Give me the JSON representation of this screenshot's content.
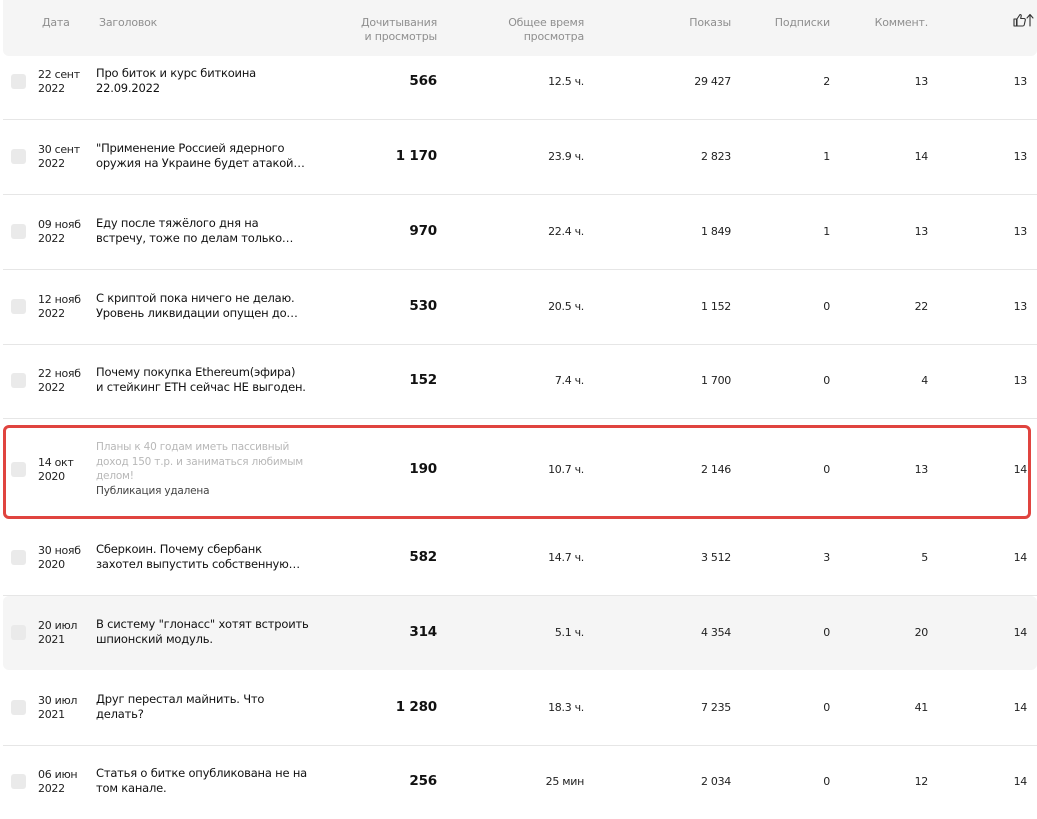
{
  "header": {
    "date": "Дата",
    "title": "Заголовок",
    "reads": [
      "Дочитывания",
      "и просмотры"
    ],
    "time": [
      "Общее время",
      "просмотра"
    ],
    "shows": "Показы",
    "subs": "Подписки",
    "comments": "Коммент."
  },
  "rows": [
    {
      "date": [
        "22 сент",
        "2022"
      ],
      "title": [
        "Про биток и курс биткоина",
        "22.09.2022"
      ],
      "reads": "566",
      "time": "12.5 ч.",
      "shows": "29 427",
      "subs": "2",
      "comments": "13",
      "likes": "13"
    },
    {
      "date": [
        "30 сент",
        "2022"
      ],
      "title": [
        "\"Применение Россией ядерного",
        "оружия на Украине будет атакой…"
      ],
      "reads": "1 170",
      "time": "23.9 ч.",
      "shows": "2 823",
      "subs": "1",
      "comments": "14",
      "likes": "13"
    },
    {
      "date": [
        "09 нояб",
        "2022"
      ],
      "title": [
        "Еду после тяжёлого дня на",
        "встречу, тоже по делам только…"
      ],
      "reads": "970",
      "time": "22.4 ч.",
      "shows": "1 849",
      "subs": "1",
      "comments": "13",
      "likes": "13"
    },
    {
      "date": [
        "12 нояб",
        "2022"
      ],
      "title": [
        "С криптой пока ничего не делаю.",
        "Уровень ликвидации опущен до…"
      ],
      "reads": "530",
      "time": "20.5 ч.",
      "shows": "1 152",
      "subs": "0",
      "comments": "22",
      "likes": "13"
    },
    {
      "date": [
        "22 нояб",
        "2022"
      ],
      "title": [
        "Почему покупка Ethereum(эфира)",
        "и стейкинг ETH сейчас НЕ выгоден."
      ],
      "reads": "152",
      "time": "7.4 ч.",
      "shows": "1 700",
      "subs": "0",
      "comments": "4",
      "likes": "13"
    },
    {
      "date": [
        "14 окт",
        "2020"
      ],
      "title": [
        "Планы к 40 годам иметь пассивный",
        "доход 150 т.р. и заниматься любимым",
        "делом!"
      ],
      "note": "Публикация удалена",
      "reads": "190",
      "time": "10.7 ч.",
      "shows": "2 146",
      "subs": "0",
      "comments": "13",
      "likes": "14"
    },
    {
      "date": [
        "30 нояб",
        "2020"
      ],
      "title": [
        "Сберкоин. Почему сбербанк",
        "захотел выпустить собственную…"
      ],
      "reads": "582",
      "time": "14.7 ч.",
      "shows": "3 512",
      "subs": "3",
      "comments": "5",
      "likes": "14"
    },
    {
      "date": [
        "20 июл",
        "2021"
      ],
      "title": [
        "В систему \"глонасс\" хотят встроить",
        "шпионский модуль."
      ],
      "reads": "314",
      "time": "5.1 ч.",
      "shows": "4 354",
      "subs": "0",
      "comments": "20",
      "likes": "14"
    },
    {
      "date": [
        "30 июл",
        "2021"
      ],
      "title": [
        "Друг перестал майнить. Что",
        "делать?"
      ],
      "reads": "1 280",
      "time": "18.3 ч.",
      "shows": "7 235",
      "subs": "0",
      "comments": "41",
      "likes": "14"
    },
    {
      "date": [
        "06 июн",
        "2022"
      ],
      "title": [
        "Статья о битке опубликована не на",
        "том канале."
      ],
      "reads": "256",
      "time": "25 мин",
      "shows": "2 034",
      "subs": "0",
      "comments": "12",
      "likes": "14"
    }
  ],
  "colors": {
    "highlight": "#e0443f",
    "header_bg": "#f5f5f5",
    "row_hover": "#f5f5f5"
  },
  "icons": {
    "sort": "thumb-up-arrow-up-icon"
  }
}
